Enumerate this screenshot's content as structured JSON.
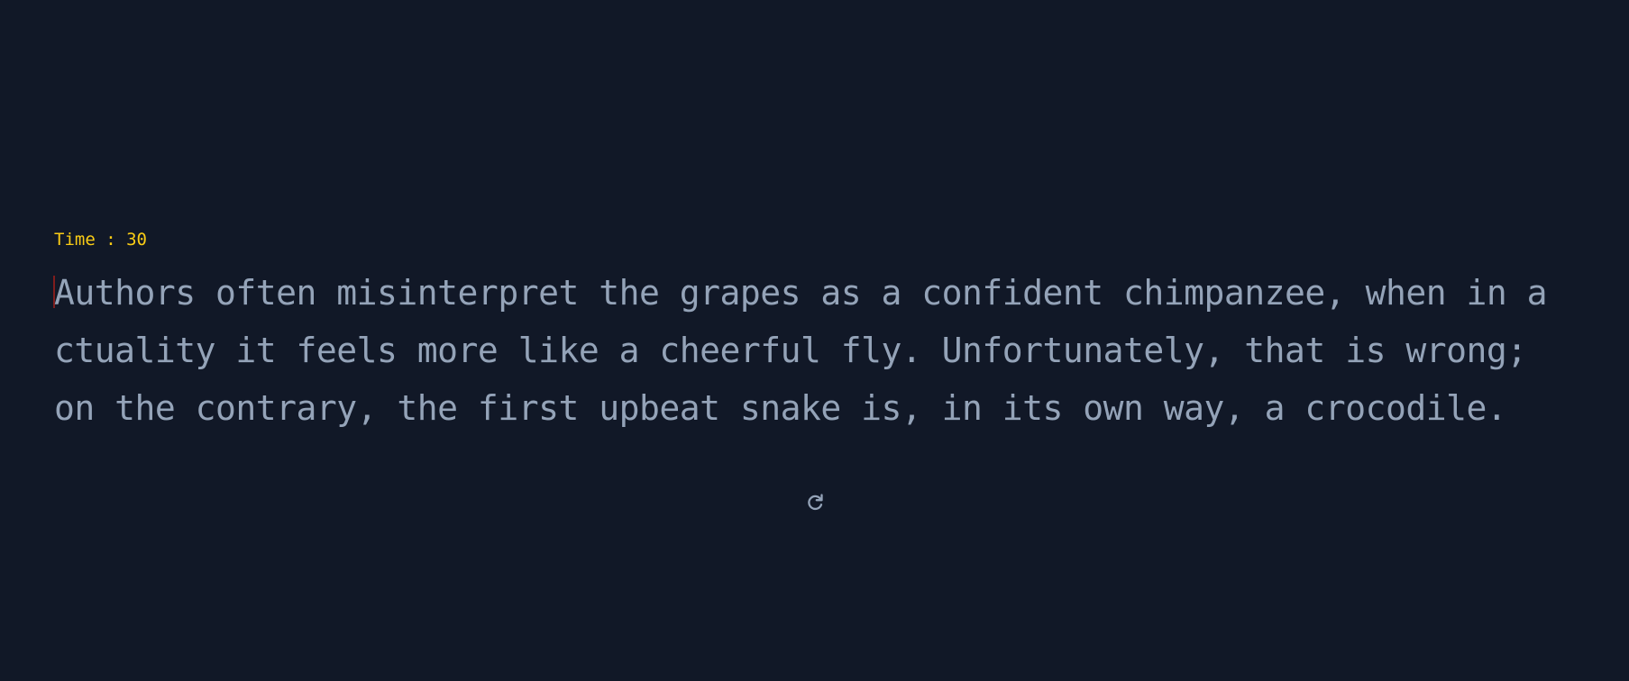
{
  "timer": {
    "label": "Time : 30"
  },
  "passage": {
    "lines": [
      "Authors often misinterpret the grapes as a confident chimpanzee, when in a",
      "ctuality it feels more like a cheerful fly. Unfortunately, that is wrong;",
      "on the contrary, the first upbeat snake is, in its own way, a crocodile."
    ]
  },
  "controls": {
    "restart_icon": "restart-icon"
  },
  "colors": {
    "background": "#111827",
    "timer": "#facc15",
    "text": "#94a3b8",
    "caret": "#7f1d1d",
    "icon": "#94a3b8"
  }
}
